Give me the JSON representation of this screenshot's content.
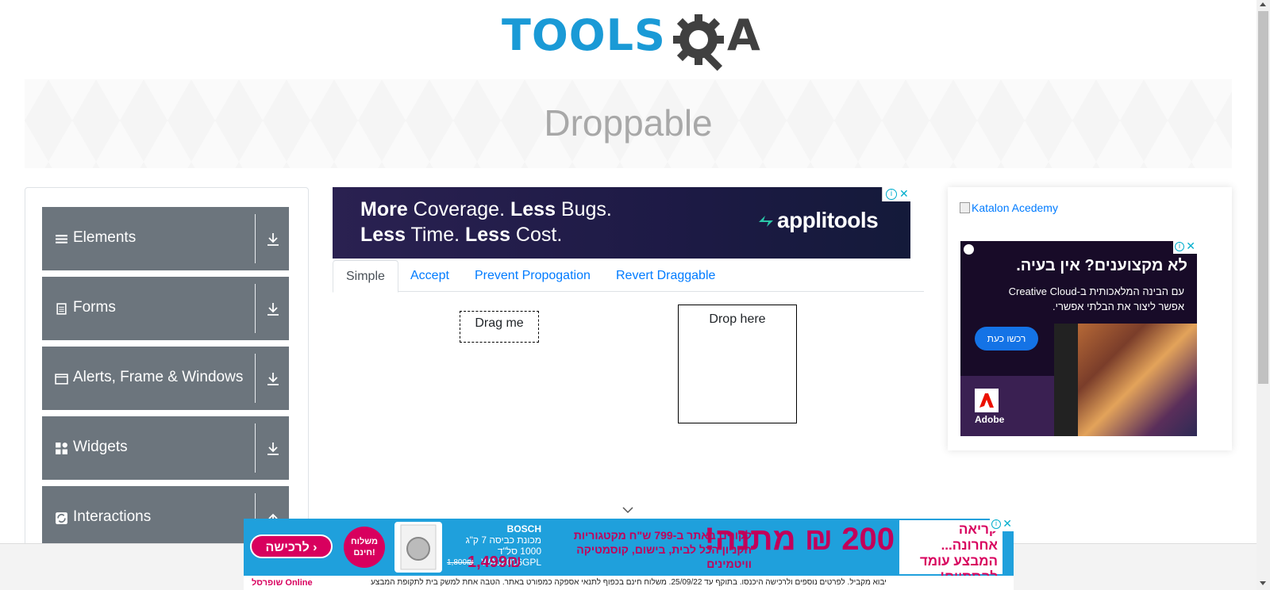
{
  "header": {
    "logo_text": "TOOLS",
    "logo_suffix": "A"
  },
  "banner": {
    "title": "Droppable"
  },
  "sidebar": {
    "groups": [
      {
        "label": "Elements",
        "icon": "hamburger-icon",
        "expanded": false
      },
      {
        "label": "Forms",
        "icon": "document-icon",
        "expanded": false
      },
      {
        "label": "Alerts, Frame & Windows",
        "icon": "window-icon",
        "expanded": false
      },
      {
        "label": "Widgets",
        "icon": "widgets-grid-icon",
        "expanded": false
      },
      {
        "label": "Interactions",
        "icon": "refresh-icon",
        "expanded": true
      }
    ]
  },
  "top_ad": {
    "line1_a": "More",
    "line1_b": " Coverage. ",
    "line1_c": "Less",
    "line1_d": " Bugs.",
    "line2_a": "Less",
    "line2_b": " Time. ",
    "line2_c": "Less",
    "line2_d": " Cost.",
    "brand": "applitools"
  },
  "tabs": [
    {
      "label": "Simple",
      "active": true
    },
    {
      "label": "Accept",
      "active": false
    },
    {
      "label": "Prevent Propogation",
      "active": false
    },
    {
      "label": "Revert Draggable",
      "active": false
    }
  ],
  "demo": {
    "drag_label": "Drag me",
    "drop_label": "Drop here"
  },
  "right_ad": {
    "katalon_alt": "Katalon Acedemy",
    "adobe_heading": "לא מקצוענים? אין בעיה.",
    "adobe_sub_1": "עם הבינה המלאכותית ב-Creative Cloud",
    "adobe_sub_2": "אפשר ליצור את הבלתי אפשרי.",
    "adobe_button": "רכשו כעת",
    "adobe_brand": "Adobe"
  },
  "bottom_ad": {
    "badge_right": "קריאה אחרונה... המבצע עומד להסתיים!",
    "big_text": "200 ₪ מתנה!",
    "mid_text": "לקונים באתר ב-799 ש\"ח מקטגוריות הקניון הכל לבית, בישום, קוסמטיקה וויטמינים",
    "specs_brand": "BOSCH",
    "specs": "מכונת כביסה 7 ק\"ג 1000 סל\"ד WAJ2006GPL",
    "price": "1,499₪",
    "was_price": "1,800₪",
    "free_delivery": "משלוח חינם!",
    "cta": "לרכישה ›",
    "brand_left": "שופרסל Online",
    "footnote": "יבוא מקביל. לפרטים נוספים ולרכישה היכנסו. בתוקף עד 25/09/22. משלוח חינם בכפוף לתנאי אספקה כמפורט באתר. הטבה אחת למשק בית לתקופת המבצע"
  },
  "colors": {
    "logo_blue": "#1a9ad6",
    "logo_dark": "#404040",
    "sidebar_group_bg": "#6c757d",
    "tab_link": "#007bff"
  }
}
